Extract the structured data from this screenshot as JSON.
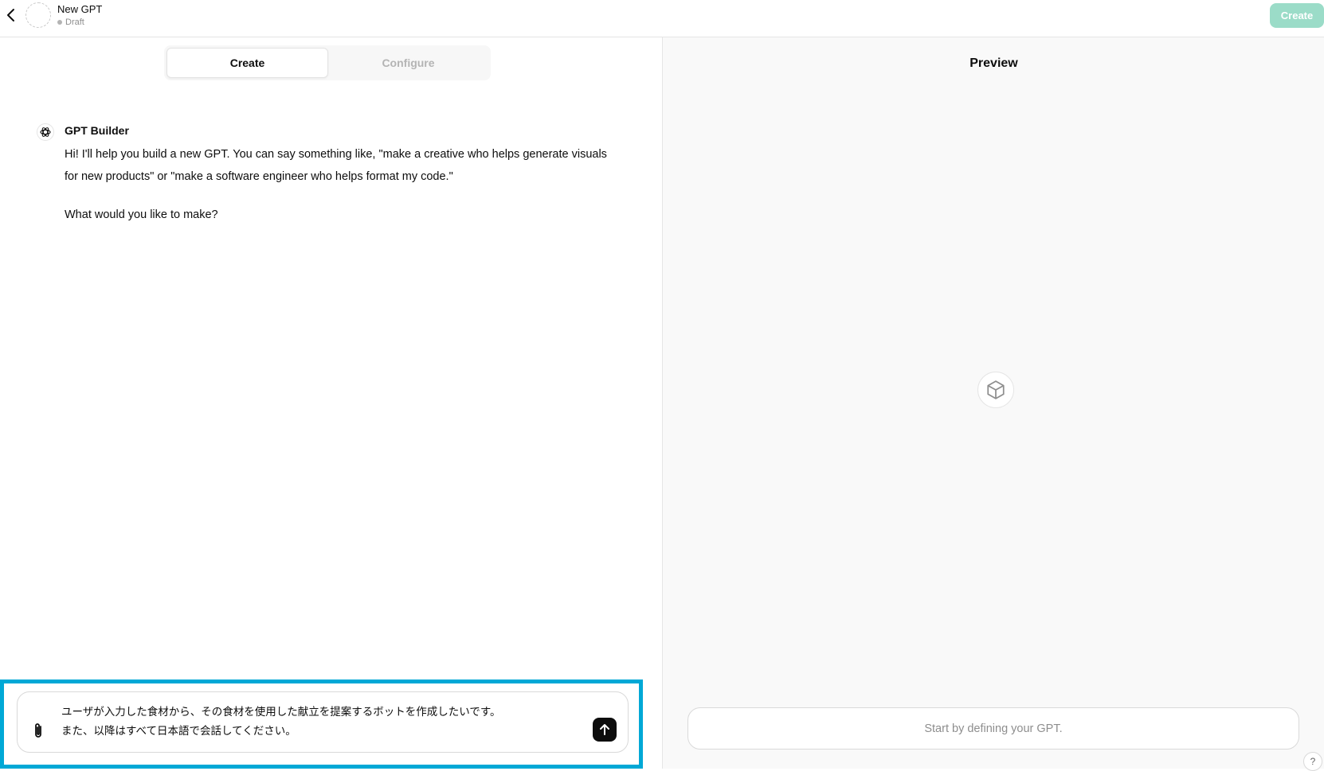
{
  "header": {
    "gpt_name": "New GPT",
    "status": "Draft",
    "create_label": "Create"
  },
  "tabs": [
    {
      "label": "Create",
      "active": true
    },
    {
      "label": "Configure",
      "active": false
    }
  ],
  "chat": {
    "author": "GPT Builder",
    "paragraphs": [
      "Hi! I'll help you build a new GPT. You can say something like, \"make a creative who helps generate visuals for new products\" or \"make a software engineer who helps format my code.\"",
      "What would you like to make?"
    ]
  },
  "composer": {
    "value": "ユーザが入力した食材から、その食材を使用した献立を提案するボットを作成したいです。\nまた、以降はすべて日本語で会話してください。"
  },
  "preview": {
    "title": "Preview",
    "input_placeholder": "Start by defining your GPT.",
    "help_label": "?"
  },
  "colors": {
    "accent_highlight": "#00a8d6",
    "create_button": "#9bdcc8"
  }
}
